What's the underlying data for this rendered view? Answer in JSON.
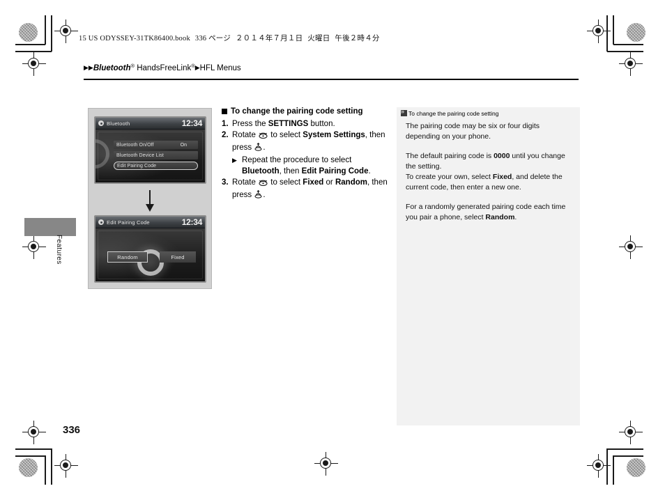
{
  "header": {
    "file_line": "15 US ODYSSEY-31TK86400.book",
    "page_ref": "336 ページ",
    "date": "２０１４年７月１日",
    "weekday": "火曜日",
    "time": "午後２時４分"
  },
  "breadcrumb": {
    "arrow1": "▶▶",
    "item1": "Bluetooth",
    "sup1": "®",
    "item2": " HandsFreeLink",
    "sup2": "®",
    "arrow2": "▶",
    "item3": "HFL Menus"
  },
  "side_tab": {
    "label": "Features"
  },
  "page_number": "336",
  "screens": [
    {
      "title": "Bluetooth",
      "clock": "12:34",
      "rows": [
        {
          "label": "Bluetooth On/Off",
          "value": "On",
          "selected": false
        },
        {
          "label": "Bluetooth Device List",
          "value": "",
          "selected": false
        },
        {
          "label": "Edit Pairing Code",
          "value": "",
          "selected": true
        }
      ]
    },
    {
      "title": "Edit Pairing Code",
      "clock": "12:34",
      "choices": [
        {
          "label": "Random",
          "selected": true
        },
        {
          "label": "Fixed",
          "selected": false
        }
      ]
    }
  ],
  "instructions": {
    "heading": "To change the pairing code setting",
    "steps": [
      {
        "num": "1.",
        "text_before": "Press the ",
        "bold1": "SETTINGS",
        "text_after": " button."
      },
      {
        "num": "2.",
        "text_before": "Rotate ",
        "glyph1": "dial-knob-icon",
        "text_mid": " to select ",
        "bold1": "System Settings",
        "text_after": ", then press ",
        "glyph2": "enter-knob-icon",
        "text_end": "."
      },
      {
        "num": "3.",
        "text_before": "Rotate ",
        "glyph1": "dial-knob-icon",
        "text_mid": " to select ",
        "bold1": "Fixed",
        "text_or": " or ",
        "bold2": "Random",
        "text_after": ", then press ",
        "glyph2": "enter-knob-icon",
        "text_end": "."
      }
    ],
    "substep": {
      "triangle": "▶",
      "text_before": "Repeat the procedure to select ",
      "bold1": "Bluetooth",
      "text_mid": ", then ",
      "bold2": "Edit Pairing Code",
      "text_after": "."
    }
  },
  "note": {
    "title": "To change the pairing code setting",
    "paragraph1": "The pairing code may be six or four digits depending on your phone.",
    "paragraph2_pre": "The default pairing code is ",
    "paragraph2_bold": "0000",
    "paragraph2_mid": " until you change the setting.",
    "paragraph2_line2_pre": "To create your own, select ",
    "paragraph2_bold2": "Fixed",
    "paragraph2_post": ", and delete the current code, then enter a new one.",
    "paragraph3_pre": "For a randomly generated pairing code each time you pair a phone, select ",
    "paragraph3_bold": "Random",
    "paragraph3_post": "."
  },
  "colors": {
    "tab_gray": "#878787",
    "screen_frame": "#d0d0d0",
    "note_bg": "#f2f2f2",
    "ink": "#000000"
  }
}
